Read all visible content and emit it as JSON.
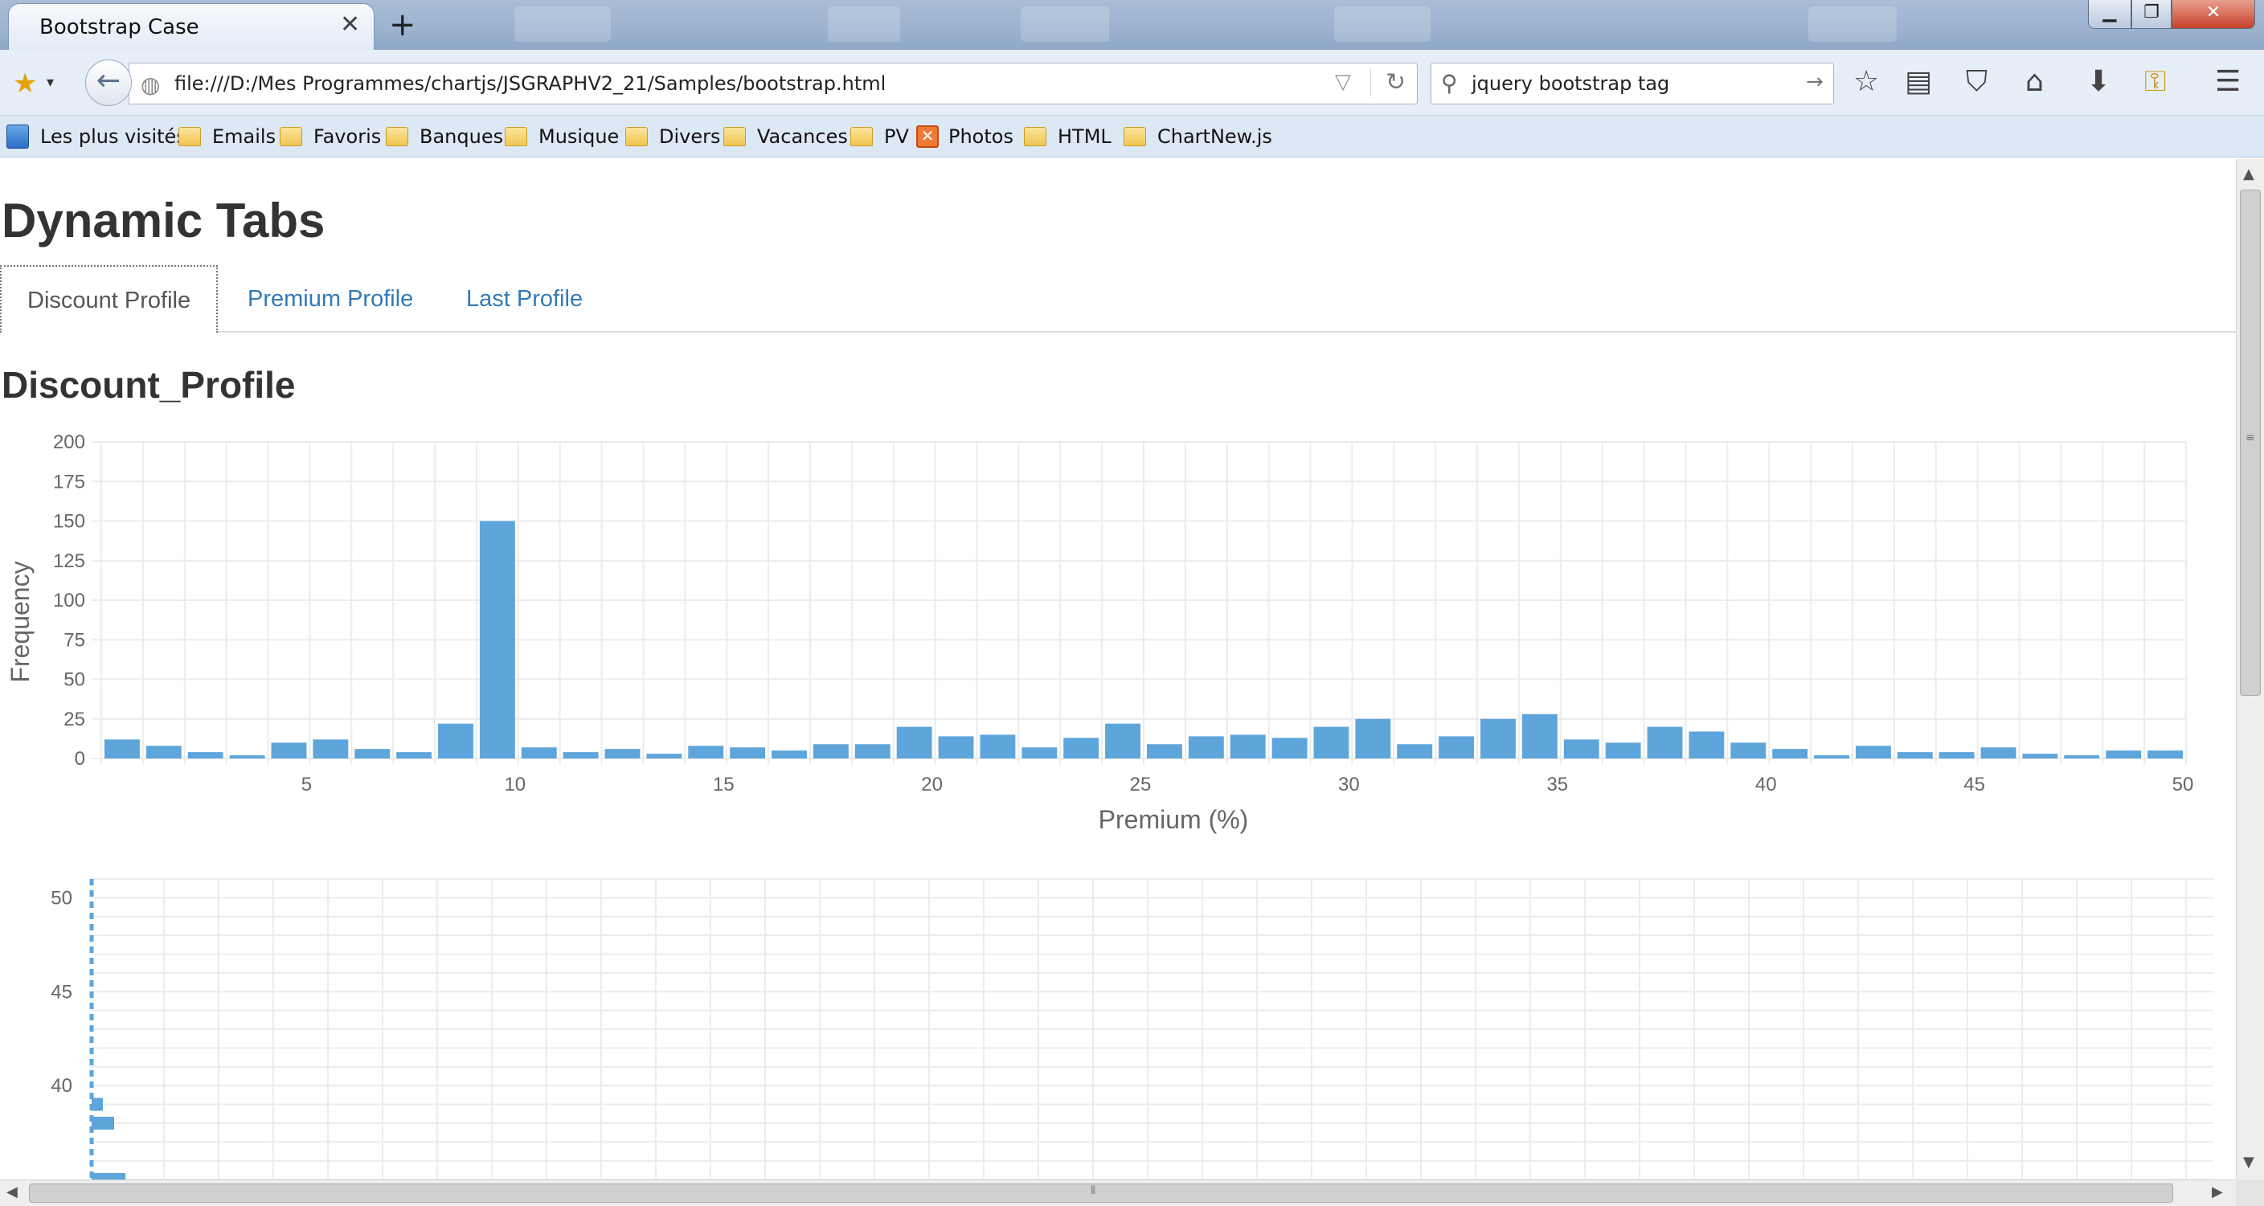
{
  "browser": {
    "tab_title": "Bootstrap Case",
    "tab_close": "✕",
    "new_tab": "+",
    "url": "file:///D:/Mes Programmes/chartjs/JSGRAPHV2_21/Samples/bootstrap.html",
    "search_value": "jquery bootstrap tag",
    "window_buttons": {
      "minimize": "▁",
      "maximize": "❐",
      "close": "✕"
    },
    "toolbar_icons": [
      "star-icon",
      "reading-list-icon",
      "pocket-icon",
      "home-icon",
      "download-icon",
      "key-icon",
      "menu-icon"
    ]
  },
  "bookmarks": {
    "items": [
      {
        "label": "Les plus visités",
        "icon": "most-visited-icon"
      },
      {
        "label": "Emails",
        "icon": "folder-icon"
      },
      {
        "label": "Favoris",
        "icon": "folder-icon"
      },
      {
        "label": "Banques",
        "icon": "folder-icon"
      },
      {
        "label": "Musique",
        "icon": "folder-icon"
      },
      {
        "label": "Divers",
        "icon": "folder-icon"
      },
      {
        "label": "Vacances",
        "icon": "folder-icon"
      },
      {
        "label": "PV",
        "icon": "folder-icon"
      },
      {
        "label": "Photos",
        "icon": "photos-icon"
      },
      {
        "label": "HTML",
        "icon": "folder-icon"
      },
      {
        "label": "ChartNew.js",
        "icon": "folder-icon"
      }
    ]
  },
  "page": {
    "title": "Dynamic Tabs",
    "tabs": [
      {
        "label": "Discount Profile",
        "active": true
      },
      {
        "label": "Premium Profile",
        "active": false
      },
      {
        "label": "Last Profile",
        "active": false
      }
    ],
    "section_title": "Discount_Profile",
    "colors": {
      "bar": "#5da5da",
      "link": "#337ab7",
      "grid": "#ececec",
      "tick": "#666666"
    }
  },
  "chart_data": [
    {
      "type": "bar",
      "title": "",
      "xlabel": "Premium (%)",
      "ylabel": "Frequency",
      "x": [
        1,
        2,
        3,
        4,
        5,
        6,
        7,
        8,
        9,
        10,
        11,
        12,
        13,
        14,
        15,
        16,
        17,
        18,
        19,
        20,
        21,
        22,
        23,
        24,
        25,
        26,
        27,
        28,
        29,
        30,
        31,
        32,
        33,
        34,
        35,
        36,
        37,
        38,
        39,
        40,
        41,
        42,
        43,
        44,
        45,
        46,
        47,
        48,
        49,
        50
      ],
      "values": [
        12,
        8,
        4,
        2,
        10,
        12,
        6,
        4,
        22,
        150,
        7,
        4,
        6,
        3,
        8,
        7,
        5,
        9,
        9,
        20,
        14,
        15,
        7,
        13,
        22,
        9,
        14,
        15,
        13,
        20,
        25,
        9,
        14,
        25,
        28,
        12,
        10,
        20,
        17,
        10,
        6,
        2,
        8,
        4,
        4,
        7,
        3,
        2,
        5,
        5
      ],
      "ylim": [
        0,
        200
      ],
      "yticks": [
        0,
        25,
        50,
        75,
        100,
        125,
        150,
        175,
        200
      ],
      "xticks": [
        5,
        10,
        15,
        20,
        25,
        30,
        35,
        40,
        45,
        50
      ],
      "grid": true,
      "legend": "none"
    },
    {
      "type": "bar",
      "title": "",
      "yticks_visible": [
        50,
        45,
        40
      ],
      "ylim_visible": [
        35,
        51
      ],
      "bars": [
        {
          "y": 39,
          "value": 1
        },
        {
          "y": 38,
          "value": 2
        },
        {
          "y": 35,
          "value": 3
        }
      ],
      "grid": true,
      "legend": "none"
    }
  ]
}
